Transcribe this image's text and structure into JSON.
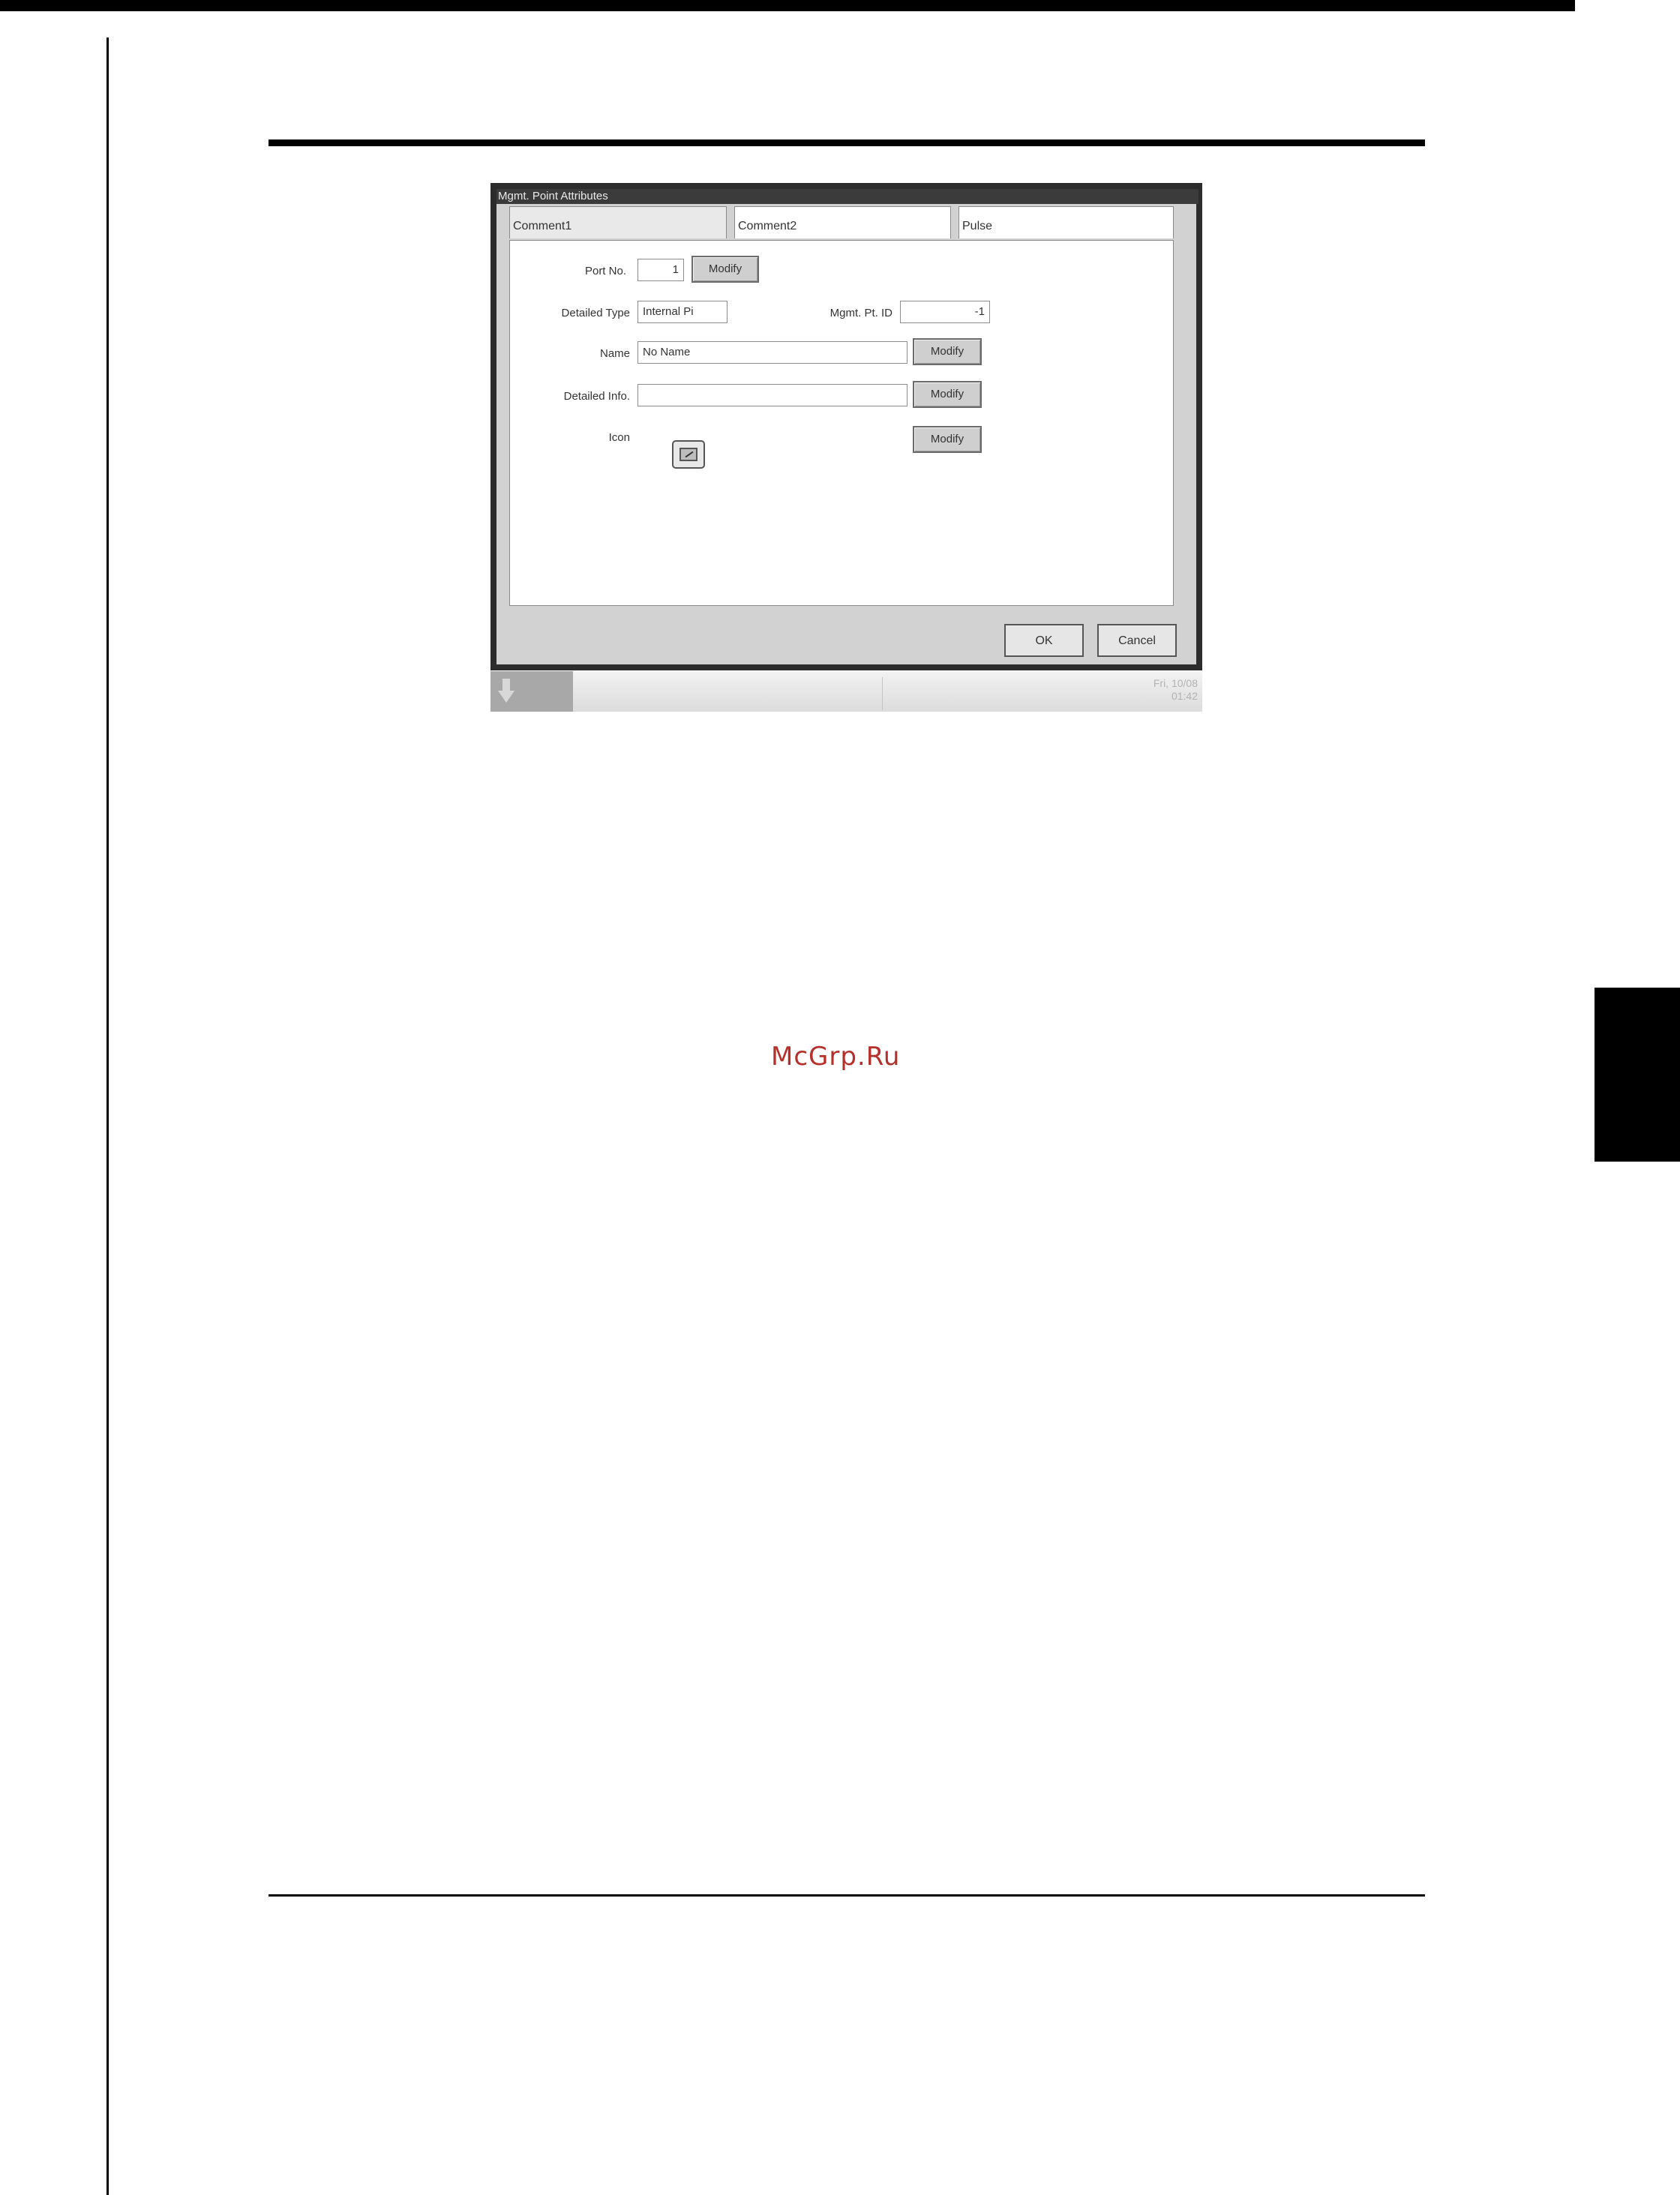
{
  "watermark": "McGrp.Ru",
  "window": {
    "title": "Mgmt. Point Attributes",
    "tabs": [
      {
        "label": "Comment1"
      },
      {
        "label": "Comment2"
      },
      {
        "label": "Pulse"
      }
    ]
  },
  "form": {
    "port_no": {
      "label": "Port No.",
      "value": "1",
      "button": "Modify"
    },
    "detailed_type": {
      "label": "Detailed Type",
      "value": "Internal Pi"
    },
    "mgmt_pt_id": {
      "label": "Mgmt. Pt. ID",
      "value": "-1"
    },
    "name": {
      "label": "Name",
      "value": "No Name",
      "button": "Modify"
    },
    "detailed_info": {
      "label": "Detailed Info.",
      "value": "",
      "button": "Modify"
    },
    "icon": {
      "label": "Icon",
      "button": "Modify",
      "icon_name": "edit-icon"
    }
  },
  "footer": {
    "ok": "OK",
    "cancel": "Cancel"
  },
  "taskbar": {
    "clock_day": "Fri, 10/08",
    "clock_time": "01:42"
  }
}
